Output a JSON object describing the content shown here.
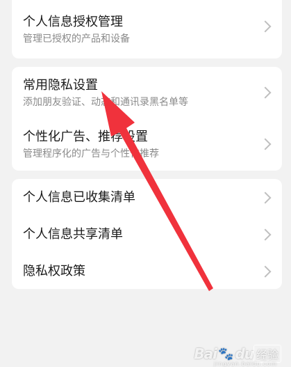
{
  "section1": {
    "items": [
      {
        "title": "个人信息授权管理",
        "subtitle": "管理已授权的产品和设备"
      }
    ]
  },
  "section2": {
    "items": [
      {
        "title": "常用隐私设置",
        "subtitle": "添加朋友验证、动态和通讯录黑名单等"
      },
      {
        "title": "个性化广告、推荐设置",
        "subtitle": "管理程序化的广告与个性化推荐"
      }
    ]
  },
  "section3": {
    "items": [
      {
        "title": "个人信息已收集清单"
      },
      {
        "title": "个人信息共享清单"
      },
      {
        "title": "隐私权政策"
      }
    ]
  },
  "annotation": {
    "arrow_color": "#f0323c"
  },
  "watermark": {
    "logo": "Bai",
    "logo_tail": "du",
    "text": "经验",
    "sub": "jingyan.baidu.com"
  },
  "icons": {
    "chevron": "chevron-right-icon",
    "arrow": "red-arrow-annotation"
  }
}
